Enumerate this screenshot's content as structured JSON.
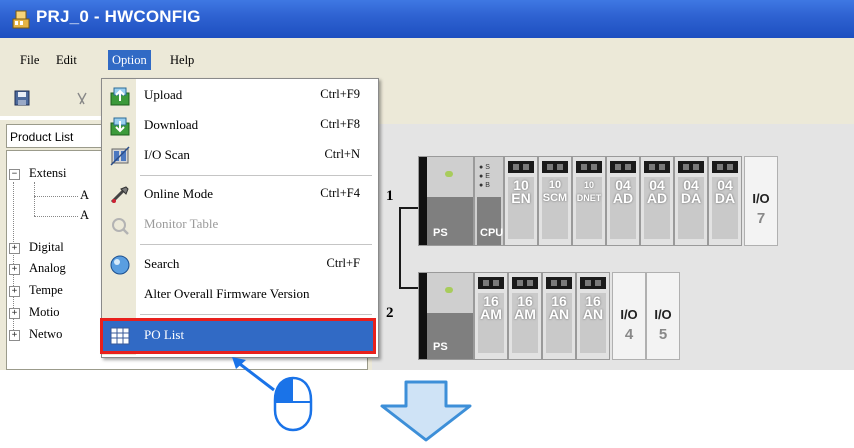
{
  "window": {
    "title": "PRJ_0 - HWCONFIG"
  },
  "menubar": [
    {
      "key": "file",
      "label": "File"
    },
    {
      "key": "edit",
      "label": "Edit"
    },
    {
      "key": "option",
      "label": "Option"
    },
    {
      "key": "help",
      "label": "Help"
    }
  ],
  "left_panel": {
    "tab_label": "Product List",
    "tree": [
      {
        "label": "Extensi",
        "expander": "−"
      },
      {
        "label": "A",
        "expander": ""
      },
      {
        "label": "A",
        "expander": ""
      },
      {
        "label": "Digital",
        "expander": "+"
      },
      {
        "label": "Analog",
        "expander": "+"
      },
      {
        "label": "Tempe",
        "expander": "+"
      },
      {
        "label": "Motio",
        "expander": "+"
      },
      {
        "label": "Netwo",
        "expander": "+"
      }
    ]
  },
  "dropdown": {
    "items": [
      {
        "label": "Upload",
        "shortcut": "Ctrl+F9",
        "icon": "upload-icon",
        "state": "normal"
      },
      {
        "label": "Download",
        "shortcut": "Ctrl+F8",
        "icon": "download-icon",
        "state": "normal"
      },
      {
        "label": "I/O Scan",
        "shortcut": "Ctrl+N",
        "icon": "io-scan-icon",
        "state": "normal"
      },
      {
        "label": "Online Mode",
        "shortcut": "Ctrl+F4",
        "icon": "online-mode-icon",
        "state": "normal"
      },
      {
        "label": "Monitor Table",
        "shortcut": "",
        "icon": "monitor-table-icon",
        "state": "disabled"
      },
      {
        "label": "Search",
        "shortcut": "Ctrl+F",
        "icon": "search-icon",
        "state": "normal"
      },
      {
        "label": "Alter Overall Firmware Version",
        "shortcut": "",
        "icon": "",
        "state": "normal"
      },
      {
        "label": "PO List",
        "shortcut": "",
        "icon": "po-list-icon",
        "state": "selected"
      }
    ]
  },
  "racks": [
    {
      "number": "1",
      "modules": [
        {
          "type": "ps",
          "label": "PS"
        },
        {
          "type": "cpu",
          "label": "CPU",
          "leds": [
            "S",
            "E",
            "B"
          ]
        },
        {
          "type": "module",
          "label": "10\nEN"
        },
        {
          "type": "module",
          "label": "10\nSCM"
        },
        {
          "type": "module",
          "label": "10\nDNET"
        },
        {
          "type": "module",
          "label": "04\nAD"
        },
        {
          "type": "module",
          "label": "04\nAD"
        },
        {
          "type": "module",
          "label": "04\nDA"
        },
        {
          "type": "module",
          "label": "04\nDA"
        },
        {
          "type": "io",
          "label": "I/O",
          "num": "7"
        }
      ]
    },
    {
      "number": "2",
      "modules": [
        {
          "type": "ps",
          "label": "PS"
        },
        {
          "type": "module",
          "label": "16\nAM"
        },
        {
          "type": "module",
          "label": "16\nAM"
        },
        {
          "type": "module",
          "label": "16\nAN"
        },
        {
          "type": "module",
          "label": "16\nAN"
        },
        {
          "type": "io",
          "label": "I/O",
          "num": "4"
        },
        {
          "type": "io",
          "label": "I/O",
          "num": "5"
        }
      ]
    }
  ],
  "colors": {
    "titlebar": "#2f63d2",
    "menu_highlight": "#316ac5",
    "annotation_red": "#e8201c",
    "annotation_blue": "#1a73e8"
  }
}
